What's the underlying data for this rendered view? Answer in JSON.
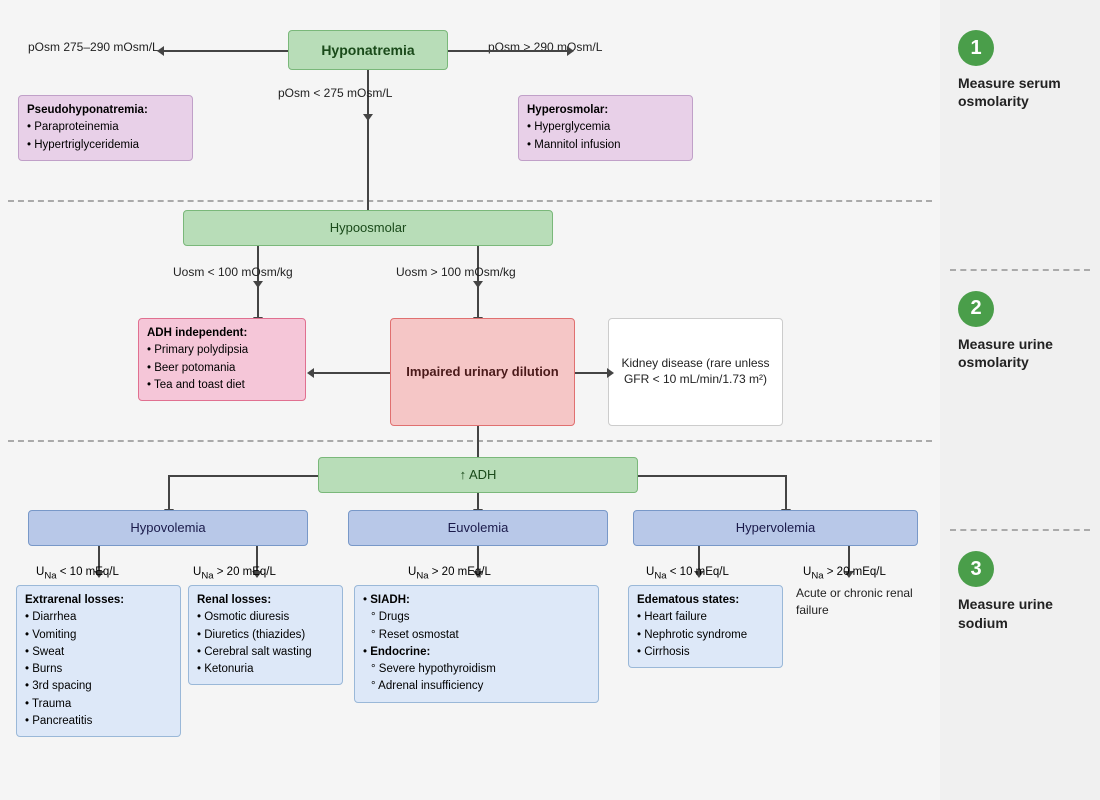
{
  "sidebar": {
    "steps": [
      {
        "number": "1",
        "label": "Measure serum osmolarity"
      },
      {
        "number": "2",
        "label": "Measure urine osmolarity"
      },
      {
        "number": "3",
        "label": "Measure urine sodium"
      }
    ]
  },
  "nodes": {
    "hyponatremia": "Hyponatremia",
    "posm_low": "pOsm 275–290 mOsm/L",
    "posm_high": "pOsm > 290 mOsm/L",
    "posm_275": "pOsm < 275 mOsm/L",
    "pseudohypo": "Pseudohyponatremia:",
    "pseudohypo_items": [
      "Paraproteinemia",
      "Hypertriglyceridemia"
    ],
    "hyperosmolar": "Hyperosmolar:",
    "hyperosmolar_items": [
      "Hyperglycemia",
      "Mannitol infusion"
    ],
    "hypoosmolar": "Hypoosmolar",
    "uosm_low": "Uosm < 100 mOsm/kg",
    "uosm_high": "Uosm > 100 mOsm/kg",
    "adh_independent": "ADH independent:",
    "adh_independent_items": [
      "Primary polydipsia",
      "Beer potomania",
      "Tea and toast diet"
    ],
    "impaired": "Impaired urinary dilution",
    "kidney_disease": "Kidney disease (rare unless GFR < 10 mL/min/1.73 m²)",
    "adh_up": "↑ ADH",
    "hypovolemia": "Hypovolemia",
    "euvolemia": "Euvolemia",
    "hypervolemia": "Hypervolemia",
    "una_lt10_hypo": "Uₙₐ < 10 mEq/L",
    "una_gt20_hypo": "Uₙₐ > 20 mEq/L",
    "una_gt20_eu": "Uₙₐ > 20 mEq/L",
    "una_lt10_hyper": "Uₙₐ < 10 mEq/L",
    "una_gt20_hyper": "Uₙₐ > 20 mEq/L",
    "extrarenal": {
      "title": "Extrarenal losses:",
      "items": [
        "Diarrhea",
        "Vomiting",
        "Sweat",
        "Burns",
        "3rd spacing",
        "Trauma",
        "Pancreatitis"
      ]
    },
    "renal": {
      "title": "Renal losses:",
      "items": [
        "Osmotic diuresis",
        "Diuretics (thiazides)",
        "Cerebral salt wasting",
        "Ketonuria"
      ]
    },
    "siadh": {
      "title": "SIADH:",
      "items": [
        "Drugs",
        "Reset osmostat"
      ],
      "subtitle": "Endocrine:",
      "subitems": [
        "Severe hypothyroidism",
        "Adrenal insufficiency"
      ]
    },
    "edematous": {
      "title": "Edematous states:",
      "items": [
        "Heart failure",
        "Nephrotic syndrome",
        "Cirrhosis"
      ]
    },
    "renal_failure": "Acute or chronic renal failure"
  }
}
